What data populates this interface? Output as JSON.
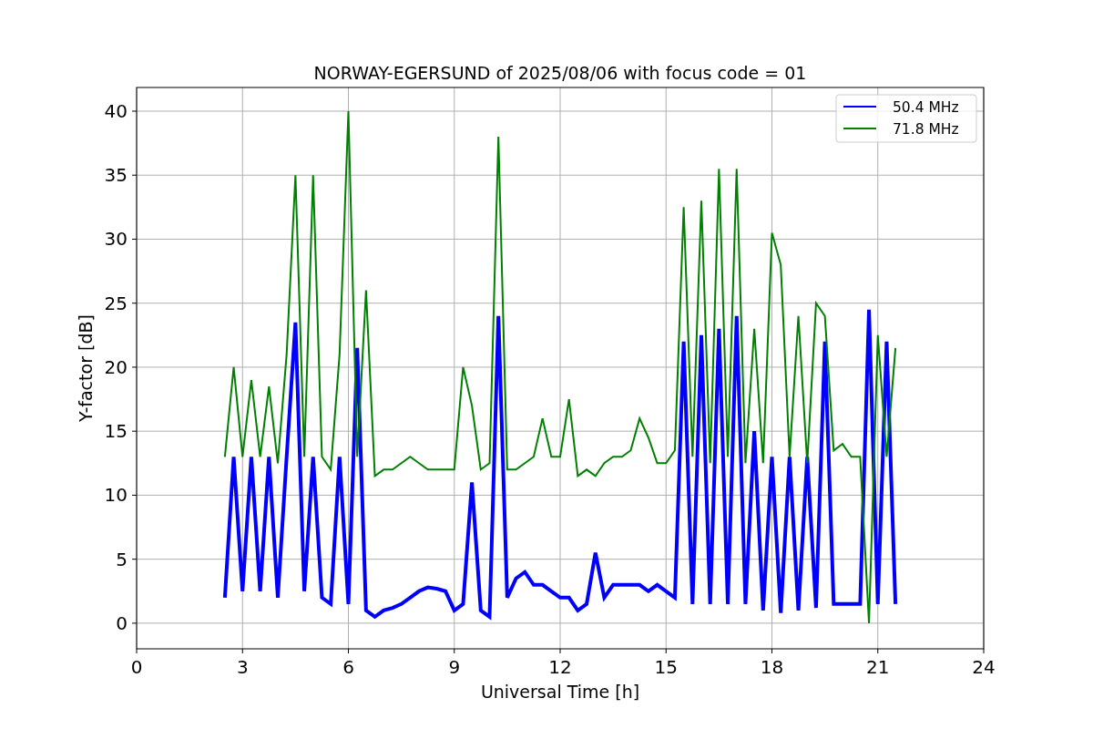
{
  "chart_data": {
    "type": "line",
    "title": "NORWAY-EGERSUND of 2025/08/06 with focus code = 01",
    "xlabel": "Universal Time [h]",
    "ylabel": "Y-factor [dB]",
    "x": [
      2.5,
      2.75,
      3,
      3.25,
      3.5,
      3.75,
      4,
      4.25,
      4.5,
      4.75,
      5,
      5.25,
      5.5,
      5.75,
      6,
      6.25,
      6.5,
      6.75,
      7,
      7.25,
      7.5,
      7.75,
      8,
      8.25,
      8.5,
      8.75,
      9,
      9.25,
      9.5,
      9.75,
      10,
      10.25,
      10.5,
      10.75,
      11,
      11.25,
      11.5,
      11.75,
      12,
      12.25,
      12.5,
      12.75,
      13,
      13.25,
      13.5,
      13.75,
      14,
      14.25,
      14.5,
      14.75,
      15,
      15.25,
      15.5,
      15.75,
      16,
      16.25,
      16.5,
      16.75,
      17,
      17.25,
      17.5,
      17.75,
      18,
      18.25,
      18.5,
      18.75,
      19,
      19.25,
      19.5,
      19.75,
      20,
      20.25,
      20.5,
      20.75,
      21,
      21.25,
      21.5
    ],
    "series": [
      {
        "name": "50.4 MHz",
        "color": "#0000ff",
        "values": [
          2,
          13,
          2.5,
          13,
          2.5,
          13,
          2,
          13,
          23.5,
          2.5,
          13,
          2,
          1.5,
          13,
          1.5,
          21.5,
          1,
          0.5,
          1,
          1.2,
          1.5,
          2,
          2.5,
          2.8,
          2.7,
          2.5,
          1,
          1.5,
          11,
          1,
          0.5,
          24,
          2,
          3.5,
          4,
          3,
          3,
          2.5,
          2,
          2,
          1,
          1.5,
          5.5,
          2,
          3,
          3,
          3,
          3,
          2.5,
          3,
          2.5,
          2,
          22,
          1.5,
          22.5,
          1.5,
          23,
          1.5,
          24,
          1.5,
          15,
          1,
          13,
          0.8,
          13,
          1,
          13,
          1.2,
          22,
          1.5,
          1.5,
          1.5,
          1.5,
          24.5,
          1.5,
          22,
          1.5
        ]
      },
      {
        "name": "71.8 MHz",
        "color": "#008000",
        "values": [
          13,
          20,
          13,
          19,
          13,
          18.5,
          12.5,
          21,
          35,
          13,
          35,
          13,
          12,
          21,
          40,
          13,
          26,
          11.5,
          12,
          12,
          12.5,
          13,
          12.5,
          12,
          12,
          12,
          12,
          20,
          17,
          12,
          12.5,
          38,
          12,
          12,
          12.5,
          13,
          16,
          13,
          13,
          17.5,
          11.5,
          12,
          11.5,
          12.5,
          13,
          13,
          13.5,
          16,
          14.5,
          12.5,
          12.5,
          13.5,
          32.5,
          13,
          33,
          12.5,
          35.5,
          13,
          35.5,
          12.5,
          23,
          12.5,
          30.5,
          28,
          13,
          24,
          12.5,
          25,
          24,
          13.5,
          14,
          13,
          13,
          0,
          22.5,
          13,
          21.5
        ]
      }
    ],
    "xlim": [
      0,
      24
    ],
    "ylim": [
      -2,
      41.85
    ],
    "grid": true,
    "legend": true,
    "xticks": [
      0,
      3,
      6,
      9,
      12,
      15,
      18,
      21,
      24
    ],
    "yticks": [
      0,
      5,
      10,
      15,
      20,
      25,
      30,
      35,
      40
    ]
  }
}
